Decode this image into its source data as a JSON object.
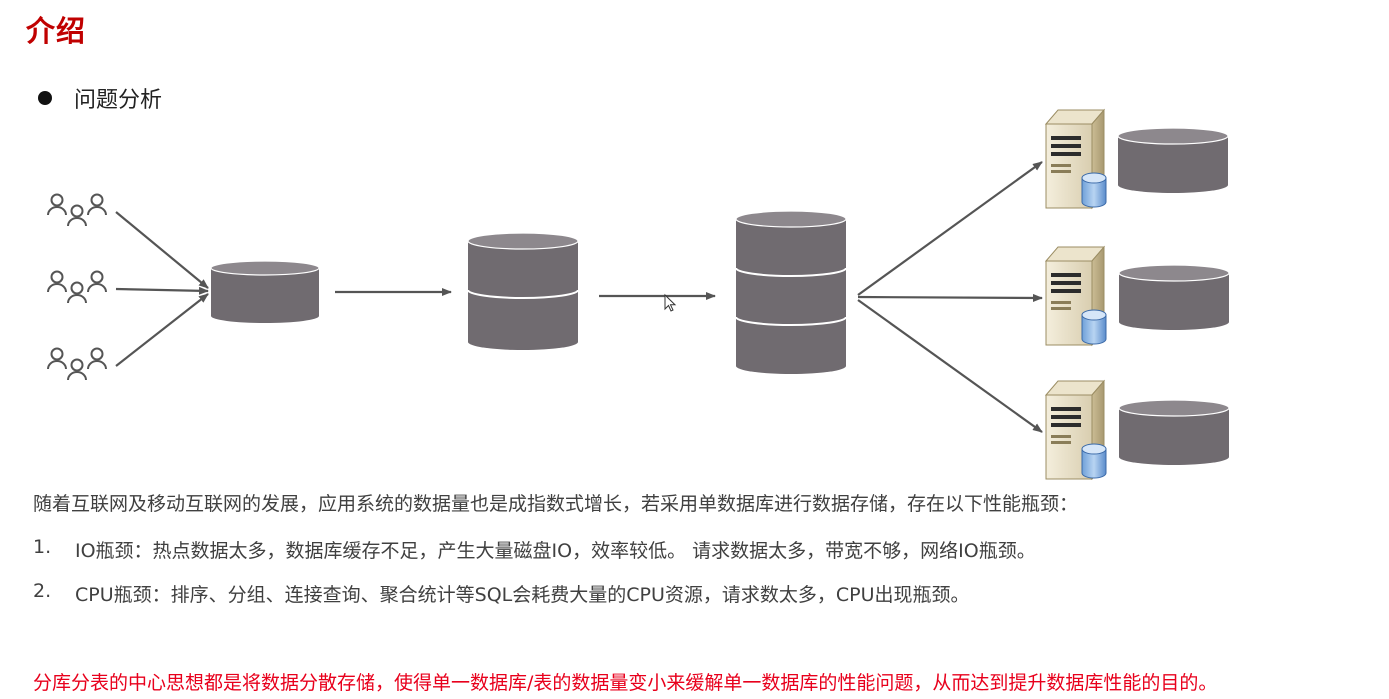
{
  "title": "介绍",
  "bullet": {
    "text": "问题分析"
  },
  "colors": {
    "title": "#c00000",
    "conclusion": "#e8001c",
    "db_body": "#706b70",
    "db_top": "#8d888d",
    "arrow": "#555555"
  },
  "diagram": {
    "icons": [
      "users-icon",
      "database-icon",
      "server-icon",
      "arrow-icon",
      "mouse-cursor-icon"
    ]
  },
  "intro": "随着互联网及移动互联网的发展，应用系统的数据量也是成指数式增长，若采用单数据库进行数据存储，存在以下性能瓶颈：",
  "items": [
    {
      "num": "1.",
      "text": "IO瓶颈：热点数据太多，数据库缓存不足，产生大量磁盘IO，效率较低。 请求数据太多，带宽不够，网络IO瓶颈。"
    },
    {
      "num": "2.",
      "text": "CPU瓶颈：排序、分组、连接查询、聚合统计等SQL会耗费大量的CPU资源，请求数太多，CPU出现瓶颈。"
    }
  ],
  "conclusion": "分库分表的中心思想都是将数据分散存储，使得单一数据库/表的数据量变小来缓解单一数据库的性能问题，从而达到提升数据库性能的目的。"
}
